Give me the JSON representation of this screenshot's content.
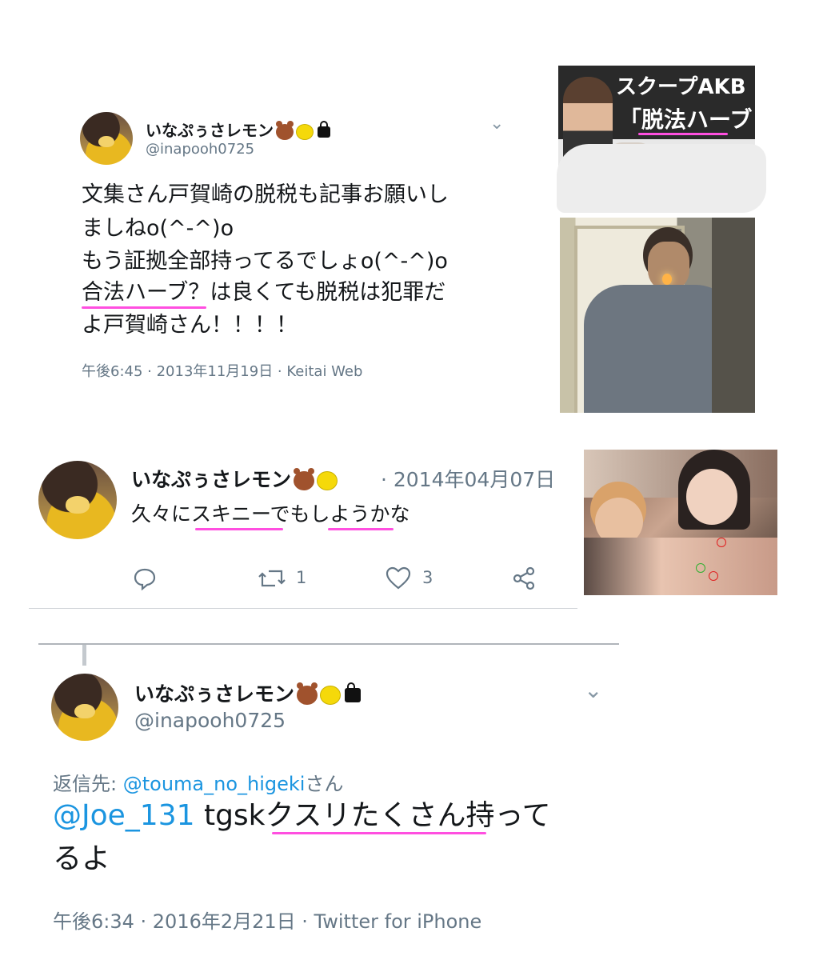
{
  "tweet1": {
    "name": "いなぷぅさレモン",
    "handle": "@inapooh0725",
    "lines": [
      "文集さん戸賀崎の脱税も記事お願いし",
      "ましねo(^-^)o",
      "もう証拠全部持ってるでしょo(^-^)o",
      "合法ハーブ？は良くても脱税は犯罪だ",
      "よ戸賀崎さん！！！！"
    ],
    "meta": "午後6:45 · 2013年11月19日 · Keitai Web"
  },
  "magazine": {
    "headline_top": "スクープAKB",
    "headline_bottom": "「脱法ハーブ"
  },
  "tweet2": {
    "name": "いなぷぅさレモン",
    "date": "· 2014年04月07日",
    "text": "久々にスキニーでもしようかな",
    "retweets": "1",
    "likes": "3"
  },
  "tweet3": {
    "name": "いなぷぅさレモン",
    "handle": "@inapooh0725",
    "reply_prefix": "返信先: ",
    "reply_to": "@touma_no_higeki",
    "reply_suffix": "さん",
    "mention": "@Joe_131",
    "text_line1": " tgskクスリたくさん持って",
    "text_line2": "るよ",
    "meta": "午後6:34 · 2016年2月21日 · Twitter for iPhone"
  },
  "colors": {
    "highlight": "#ff4fe0",
    "link": "#1b95e0",
    "meta": "#657786"
  }
}
